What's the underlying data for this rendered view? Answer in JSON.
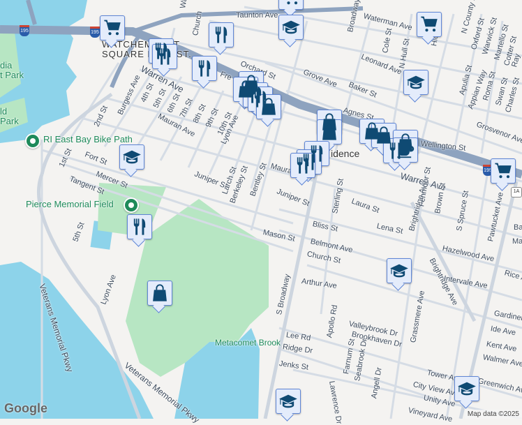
{
  "map": {
    "water_color": "#8dd3ea",
    "park_color": "#b7e6c3",
    "highway_color": "#8ea3bf",
    "marker_color": "#0f4a73",
    "neighborhood": [
      "WATCHEMOKET",
      "SQUARE HIST. ST."
    ],
    "area_partial": "idence",
    "places": {
      "bike_path": "RI East Bay Bike Path",
      "pierce_field": "Pierce Memorial Field",
      "metacomet_brook": "Metacomet Brook",
      "park_partial_1": "dia",
      "park_partial_2": "t Park",
      "park_partial_3": "ld",
      "park_partial_4": "Park"
    },
    "highway_shields": [
      "195",
      "195",
      "195",
      "1A"
    ],
    "streets": [
      "Taunton Ave",
      "Waterman Ave",
      "Broadway",
      "Orchard St",
      "Grove Ave",
      "Baker St",
      "Leonard Ave",
      "Cole St",
      "N Hull St",
      "Hicks St",
      "N County St",
      "Oxford St",
      "Warwick St",
      "Martello St",
      "Cotter St",
      "Apulia St",
      "Appian Way",
      "Roma St",
      "Swan St",
      "Charles St",
      "Agnes St",
      "Grosvenor Ave",
      "Wellington St",
      "Warren Ave",
      "Burgess Ave",
      "4th St",
      "5th St",
      "6th St",
      "7th St",
      "8th St",
      "9th St",
      "10th St",
      "Lyon Ave",
      "Mauran Ave",
      "2nd St",
      "1st St",
      "Fort St",
      "Mercer St",
      "Tangent St",
      "Juniper St",
      "Larch St",
      "Berkeley St",
      "Bentley St",
      "Laura St",
      "Sterling St",
      "Brightridge Ave",
      "Fenmoor St",
      "Brown St",
      "S Spruce St",
      "Pawtucket Ave",
      "Bliss St",
      "Lena St",
      "Mason St",
      "Belmont Ave",
      "Hazelwood Ave",
      "Church St",
      "Rice Ave",
      "Intervale Ave",
      "Arthur Ave",
      "S Broadway",
      "Gardiner St",
      "Ide Ave",
      "Kent Ave",
      "Walmer Ave",
      "Valleybrook Dr",
      "Apollo Rd",
      "Brookhaven Dr",
      "Lee Rd",
      "Ridge Dr",
      "Grassmere Ave",
      "Jenks St",
      "Farnum St",
      "Seabrook Dr",
      "Angell Dr",
      "Lawrence Dr",
      "Tower Ave",
      "Greenwich Ave",
      "City View Ave",
      "Unity Ave",
      "Vineyard Ave",
      "Veterans Memorial Pkwy",
      "Veterans Memorial Pkwy",
      "5th St",
      "Lyon Ave",
      "Fre",
      "Church",
      "Maura",
      "Wa",
      "Ma",
      "Ba",
      "Ray"
    ],
    "attribution": "Map data ©2025",
    "logo": "Google"
  }
}
